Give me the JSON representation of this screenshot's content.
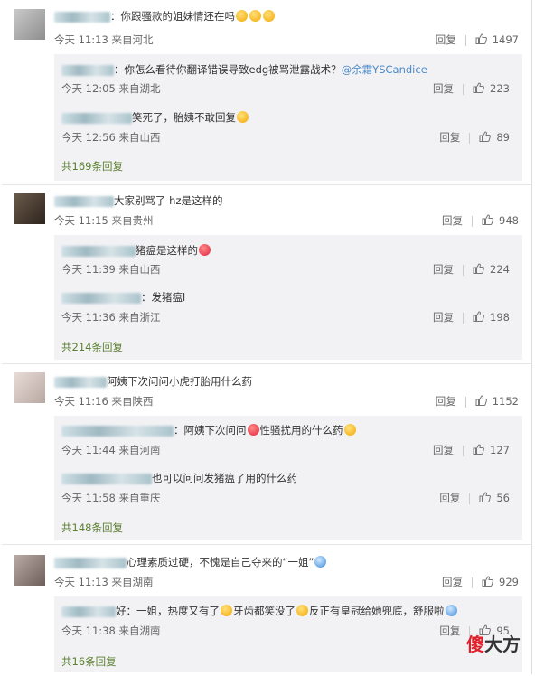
{
  "comments": [
    {
      "text": "：你跟骚款的姐妹情还在吗",
      "time": "今天 11:13",
      "source": "来自河北",
      "reply_label": "回复",
      "likes": "1497",
      "replies": [
        {
          "text_pre": "：你怎么看待你翻译错误导致edg被骂泄露战术？",
          "mention": "@余霜YSCandice",
          "time": "今天 12:05",
          "source": "来自湖北",
          "reply_label": "回复",
          "likes": "223"
        },
        {
          "text_pre": "笑死了，胎姨不敢回复",
          "mention": "",
          "time": "今天 12:56",
          "source": "来自山西",
          "reply_label": "回复",
          "likes": "89"
        }
      ],
      "more": "共169条回复"
    },
    {
      "text": "大家别骂了 hz是这样的",
      "time": "今天 11:15",
      "source": "来自贵州",
      "reply_label": "回复",
      "likes": "948",
      "replies": [
        {
          "text_pre": "猪瘟是这样的",
          "mention": "",
          "time": "今天 11:39",
          "source": "来自山西",
          "reply_label": "回复",
          "likes": "224"
        },
        {
          "text_pre": "：发猪瘟l",
          "mention": "",
          "time": "今天 11:36",
          "source": "来自浙江",
          "reply_label": "回复",
          "likes": "198"
        }
      ],
      "more": "共214条回复"
    },
    {
      "text": "阿姨下次问问小虎打胎用什么药",
      "time": "今天 11:16",
      "source": "来自陕西",
      "reply_label": "回复",
      "likes": "1152",
      "replies": [
        {
          "text_pre": "：阿姨下次问问",
          "text_post": "性骚扰用的什么药",
          "mention": "",
          "time": "今天 11:44",
          "source": "来自河南",
          "reply_label": "回复",
          "likes": "127"
        },
        {
          "text_pre": "也可以问问发猪瘟了用的什么药",
          "mention": "",
          "time": "今天 11:58",
          "source": "来自重庆",
          "reply_label": "回复",
          "likes": "56"
        }
      ],
      "more": "共148条回复"
    },
    {
      "text": "心理素质过硬，不愧是自己夺来的“一姐”",
      "time": "今天 11:13",
      "source": "来自湖南",
      "reply_label": "回复",
      "likes": "929",
      "replies": [
        {
          "text_pre": "好：一姐，热度又有了",
          "text_post": "牙齿都笑没了",
          "text_post2": "反正有皇冠给她兜底，舒服啦",
          "mention": "",
          "time": "今天 11:38",
          "source": "来自湖南",
          "reply_label": "回复",
          "likes": "95"
        }
      ],
      "more": "共16条回复"
    }
  ],
  "watermark": {
    "a": "傻",
    "b": "大方"
  },
  "colors": {
    "more_link": "#5a7f2f",
    "mention": "#4a88c7",
    "reply_bg": "#f2f2f5"
  }
}
